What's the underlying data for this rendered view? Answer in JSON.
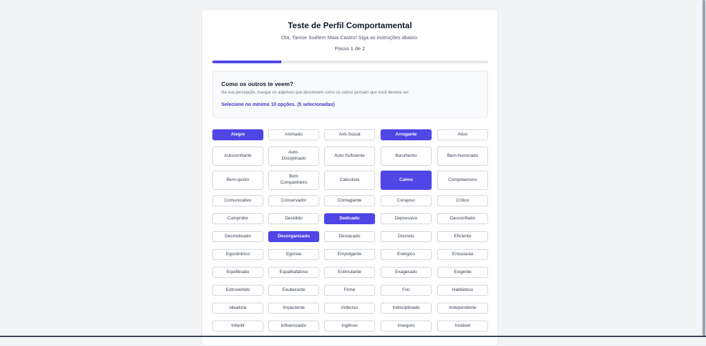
{
  "header": {
    "title": "Teste de Perfil Comportamental",
    "greeting": "Olá, Tanise Suélem Maia Castro! Siga as instruções abaixo.",
    "step": "Passo 1 de 2",
    "progress": 0.25
  },
  "question": {
    "title": "Como os outros te veem?",
    "description": "Na sua percepção, marque os adjetivos que descrevem como os outros pensam que você deveria ser.",
    "minimum": "Selecione no mínimo 10 opções. (5 selecionadas)"
  },
  "colors": {
    "accent": "#4f46e5",
    "accent_text": "#4338ca",
    "background": "#f3f4f6"
  },
  "options": [
    [
      "Alegre",
      "Animado",
      "Anti-Social",
      "Arrogante",
      "Ativo"
    ],
    [
      "Autoconfiante",
      "Auto-\nDisciplinado",
      "Auto-Suficiente",
      "Barulhento",
      "Bem-humorado"
    ],
    [
      "Bem-quisto",
      "Bom\nCompanheiro",
      "Calculista",
      "Calmo",
      "Compreensivo"
    ],
    [
      "Comunicativo",
      "Conservador",
      "Contagiante",
      "Corajoso",
      "Crítico"
    ],
    [
      "Cumpridor",
      "Decidido",
      "Dedicado",
      "Depressivo",
      "Desconfiado"
    ],
    [
      "Desmotivado",
      "Desorganizado",
      "Destacado",
      "Discreto",
      "Eficiente"
    ],
    [
      "Egocêntrico",
      "Egoísta",
      "Empolgante",
      "Enérgico",
      "Entusiasta"
    ],
    [
      "Equilibrado",
      "Espalhafatoso",
      "Estimulante",
      "Exagerado",
      "Exigente"
    ],
    [
      "Extrovertido",
      "Exuberante",
      "Firme",
      "Frio",
      "Habilidoso"
    ],
    [
      "Idealista",
      "Impaciente",
      "Indeciso",
      "Indisciplinado",
      "Independente"
    ],
    [
      "Infantil",
      "Influenciador",
      "Ingênuo",
      "Inseguro",
      "Instável"
    ]
  ],
  "selected": [
    "Alegre",
    "Arrogante",
    "Calmo",
    "Dedicado",
    "Desorganizado"
  ]
}
